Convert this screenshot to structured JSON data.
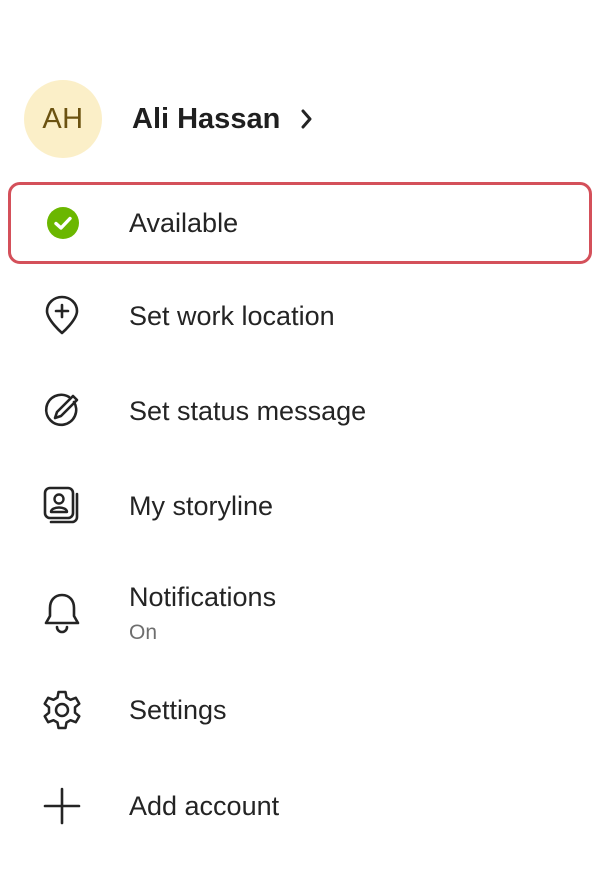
{
  "profile": {
    "initials": "AH",
    "name": "Ali Hassan",
    "avatar_bg": "#fbefc8",
    "avatar_fg": "#6b5210"
  },
  "status": {
    "label": "Available",
    "icon": "available-check-icon",
    "color": "#6bb700",
    "highlight_color": "#d4505a"
  },
  "menu": [
    {
      "label": "Set work location",
      "icon": "location-add-icon"
    },
    {
      "label": "Set status message",
      "icon": "edit-pencil-icon"
    },
    {
      "label": "My storyline",
      "icon": "storyline-icon"
    },
    {
      "label": "Notifications",
      "sublabel": "On",
      "icon": "bell-icon"
    },
    {
      "label": "Settings",
      "icon": "gear-icon"
    },
    {
      "label": "Add account",
      "icon": "plus-icon"
    }
  ]
}
